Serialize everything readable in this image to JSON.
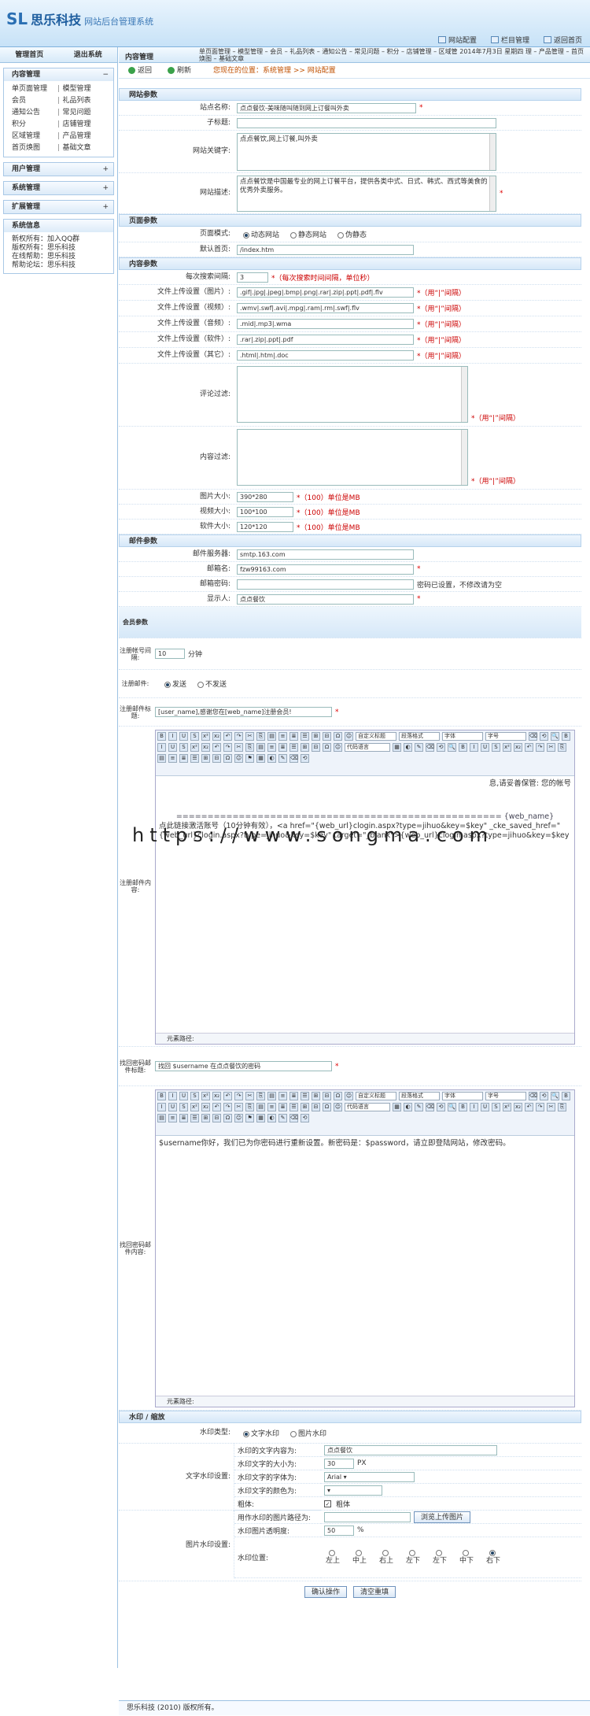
{
  "header": {
    "logo_mark": "SL",
    "brand": "思乐科技",
    "subtitle": "网站后台管理系统",
    "links": [
      "网站配置",
      "栏目管理",
      "返回首页"
    ]
  },
  "sidebar": {
    "tabs": [
      "管理首页",
      "退出系统"
    ],
    "content_box": {
      "title": "内容管理",
      "toggle": "−",
      "items": [
        "单页面管理",
        "模型管理",
        "会员",
        "礼品列表",
        "通知公告",
        "常见问题",
        "积分",
        "店铺管理",
        "区域管理",
        "产品管理",
        "首页焕图",
        "基础文章"
      ]
    },
    "collapsed": [
      {
        "title": "用户管理",
        "toggle": "+"
      },
      {
        "title": "系统管理",
        "toggle": "+"
      },
      {
        "title": "扩展管理",
        "toggle": "+"
      }
    ],
    "sysinfo": {
      "title": "系统信息",
      "lines": [
        "新权所有：加入QQ群",
        "版权所有：思乐科技",
        "在线帮助：思乐科技",
        "帮助论坛：思乐科技"
      ]
    }
  },
  "main": {
    "title": "内容管理",
    "menu": "单页面管理 – 模型管理 – 会员 – 礼品列表 – 通知公告 – 常见问题 – 积分 – 店铺管理 – 区域管 2014年7月3日 星期四 理 – 产品管理 – 首页焕图 – 基础文章",
    "back": "返回",
    "refresh": "刷新",
    "crumb": "您现在的位置：系统管理 >> 网站配置"
  },
  "site": {
    "title": "网站参数",
    "name_label": "站点名称:",
    "name": "点点餐饮-美味随叫随到网上订餐叫外卖",
    "subtitle_label": "子标题:",
    "subtitle": "",
    "keywords_label": "网站关键字:",
    "keywords": "点点餐饮,网上订餐,叫外卖",
    "desc_label": "网站描述:",
    "desc": "点点餐饮是中国最专业的网上订餐平台，提供各类中式、日式、韩式、西式等美食的优秀外卖服务。"
  },
  "page": {
    "title": "页面参数",
    "mode_label": "页面模式:",
    "modes": [
      "动态网站",
      "静态网站",
      "伪静态"
    ],
    "home_label": "默认首页:",
    "home": "/index.htm"
  },
  "contentp": {
    "title": "内容参数",
    "search_label": "每次搜索间隔:",
    "search": "3",
    "search_note": "*（每次搜索时间间隔，单位秒）",
    "uploads": [
      {
        "label": "文件上传设置（图片）:",
        "value": ".gif|.jpg|.jpeg|.bmp|.png|.rar|.zip|.ppt|.pdf|.flv",
        "note": "*（用“|”间隔）"
      },
      {
        "label": "文件上传设置（视频）:",
        "value": ".wmv|.swf|.avi|.mpg|.ram|.rm|.swf|.flv",
        "note": "*（用“|”间隔）"
      },
      {
        "label": "文件上传设置（音频）:",
        "value": ".mid|.mp3|.wma",
        "note": "*（用“|”间隔）"
      },
      {
        "label": "文件上传设置（软件）:",
        "value": ".rar|.zip|.ppt|.pdf",
        "note": "*（用“|”间隔）"
      },
      {
        "label": "文件上传设置（其它）:",
        "value": ".html|.htm|.doc",
        "note": "*（用“|”间隔）"
      }
    ],
    "comment_label": "评论过滤:",
    "comment_note": "*（用“|”间隔）",
    "filter_label": "内容过滤:",
    "filter_note": "*（用“|”间隔）",
    "sizes": [
      {
        "label": "图片大小:",
        "value": "390*280",
        "note": "*（100）单位是MB"
      },
      {
        "label": "视频大小:",
        "value": "100*100",
        "note": "*（100）单位是MB"
      },
      {
        "label": "软件大小:",
        "value": "120*120",
        "note": "*（100）单位是MB"
      }
    ]
  },
  "mail": {
    "title": "邮件参数",
    "server_label": "邮件服务器:",
    "server": "smtp.163.com",
    "name_label": "邮箱名:",
    "name": "fzw99163.com",
    "pwd_label": "邮箱密码:",
    "pwd_note": "密码已设置，不修改请为空",
    "sender_label": "显示人:",
    "sender": "点点餐饮"
  },
  "member": {
    "title": "会员参数",
    "interval_label": "注册帐号间隔:",
    "interval": "10",
    "interval_unit": "分钟",
    "send_label": "注册邮件:",
    "send_opts": [
      "发送",
      "不发送"
    ],
    "title_label": "注册邮件标题:",
    "mail_title": "[user_name],感谢您在[web_name]注册会员!",
    "body_label": "注册邮件内容:",
    "body_top": "息,请妥善保管: 您的帐号",
    "body_sep": "==================================================== {web_name}",
    "body_text": "点此链接激活账号（10分钟有效），<a href=\"{web_url}clogin.aspx?type=jihuo&key=$key\" _cke_saved_href=\"{web_url}clogin.aspx?type=jihuo&key=$key\" target=\"_blank\">{web_url}clogin.aspx?type=jihuo&key=$key",
    "path": "元素路径:",
    "find_label": "找回密码邮件标题:",
    "find_title": "找回 $username 在点点餐饮的密码",
    "find_body_label": "找回密码邮件内容:",
    "find_body": "$username你好，我们已为你密码进行重新设置。新密码是：$password，请立即登陆网站，修改密码。"
  },
  "editor": {
    "selects": [
      "自定义标题",
      "段落格式",
      "字体",
      "字号",
      "代码语言"
    ]
  },
  "watermark": {
    "title": "水印 / 缩放",
    "type_label": "水印类型:",
    "types": [
      "文字水印",
      "图片水印"
    ],
    "text_label": "文字水印设置:",
    "text_rows": [
      {
        "label": "水印的文字内容为:",
        "value": "点点餐饮"
      },
      {
        "label": "水印文字的大小为:",
        "value": "30",
        "unit": "PX"
      },
      {
        "label": "水印文字的字体为:",
        "value": "Arial"
      },
      {
        "label": "水印文字的颜色为:",
        "value": ""
      },
      {
        "label": "粗体:",
        "value": "粗体"
      }
    ],
    "img_label": "图片水印设置:",
    "img_path_label": "用作水印的图片路径为:",
    "upload_btn": "浏览上传图片",
    "alpha_label": "水印图片透明度:",
    "alpha": "50",
    "alpha_unit": "%",
    "pos_label": "水印位置:",
    "positions": [
      "左上",
      "中上",
      "右上",
      "左下",
      "左下",
      "中下",
      "右下"
    ]
  },
  "buttons": {
    "ok": "确认操作",
    "reset": "清空重填"
  },
  "overlay": "https://www.songma.com",
  "footer": "思乐科技 (2010) 版权所有。"
}
